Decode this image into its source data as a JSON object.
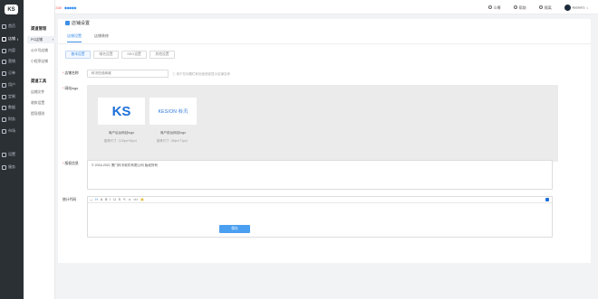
{
  "sidebar": {
    "logo": "KS",
    "items": [
      {
        "label": "首页"
      },
      {
        "label": "店铺",
        "badge": "I",
        "active": true
      },
      {
        "label": "内容"
      },
      {
        "label": "营销"
      },
      {
        "label": "订单"
      },
      {
        "label": "用户"
      },
      {
        "label": "定制"
      },
      {
        "label": "数据"
      },
      {
        "label": "财务"
      },
      {
        "label": "市场"
      },
      {
        "label": "设置"
      },
      {
        "label": "服务"
      }
    ]
  },
  "subnav": {
    "section1": "渠道管理",
    "items1": [
      {
        "label": "PC店铺",
        "active": true
      },
      {
        "label": "公众号店铺"
      },
      {
        "label": "小程序店铺"
      }
    ],
    "section2": "渠道工具",
    "items2": [
      {
        "label": "店铺文件"
      },
      {
        "label": "收款设置"
      },
      {
        "label": "提现规则"
      }
    ]
  },
  "topbar": {
    "sms_label": "短信剩余数:",
    "sms_count": "5340",
    "diamonds": "◆◆◆◆◆",
    "links": [
      "众筹",
      "帮助",
      "隔离"
    ],
    "user": "kesion1"
  },
  "page": {
    "title": "店铺设置",
    "tabs": [
      "店铺设置",
      "店铺装修"
    ],
    "subtabs": [
      "基本设置",
      "域名设置",
      "SEO设置",
      "其他设置"
    ],
    "shop_name_label": "店铺名称",
    "shop_name_value": "科汛在线商城",
    "shop_name_hint": "用于在标题栏和页面底部显示店铺名称",
    "logo_label": "网站logo",
    "logos": [
      {
        "text": "KS",
        "caption": "商户后台网站logo",
        "size": "推荐尺寸（120px*40px）"
      },
      {
        "text": "KESION 科汛",
        "caption": "商户前台网站logo",
        "size": "推荐尺寸（80px*71px）"
      }
    ],
    "copyright_label": "版权信息",
    "copyright_value": "© 2016-2021 厦门科汛软件有限公司 版权所有",
    "stats_label": "统计代码",
    "toolbar": [
      "—",
      "H",
      "A",
      "B",
      "I",
      "U",
      "S",
      "✎",
      "∞",
      "</>",
      "▦"
    ],
    "save_label": "保存"
  }
}
